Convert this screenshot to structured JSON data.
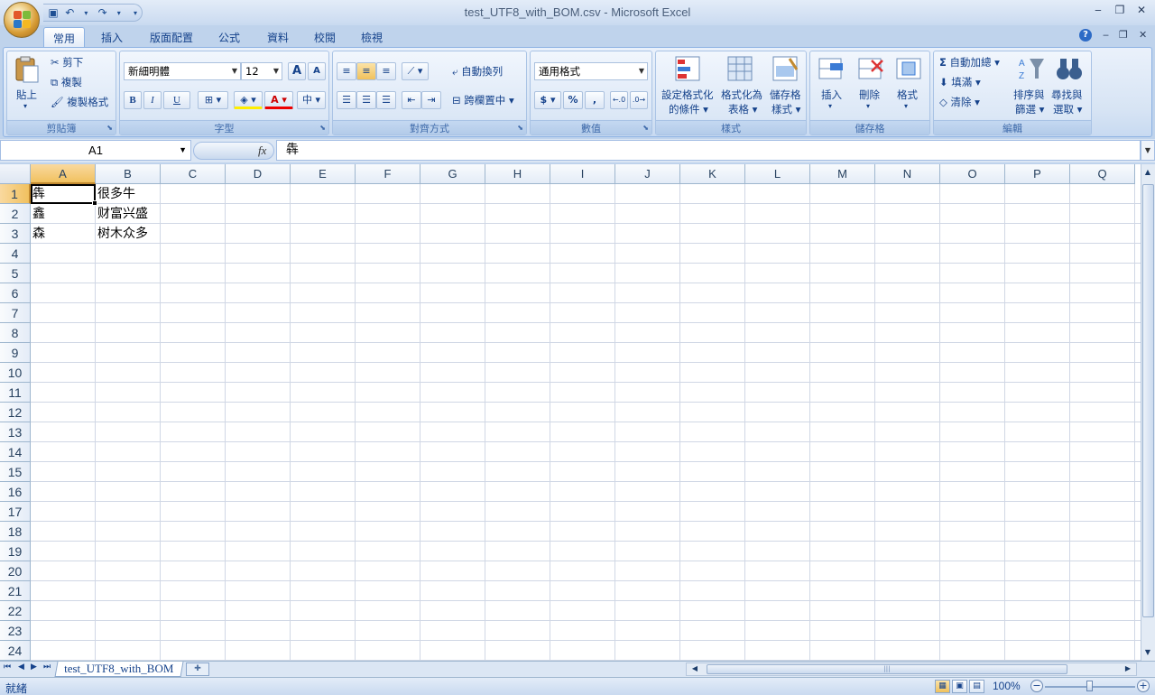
{
  "window": {
    "title": "test_UTF8_with_BOM.csv - Microsoft Excel"
  },
  "tabs": [
    {
      "label": "常用"
    },
    {
      "label": "插入"
    },
    {
      "label": "版面配置"
    },
    {
      "label": "公式"
    },
    {
      "label": "資料"
    },
    {
      "label": "校閱"
    },
    {
      "label": "檢視"
    }
  ],
  "ribbon": {
    "clipboard": {
      "label": "剪貼簿",
      "paste": "貼上",
      "cut": "剪下",
      "copy": "複製",
      "format_painter": "複製格式"
    },
    "font": {
      "label": "字型",
      "font_name": "新細明體",
      "font_size": "12",
      "grow": "A",
      "shrink": "A",
      "bold": "B",
      "italic": "I",
      "underline": "U",
      "font_color": "A",
      "phonetic": "中"
    },
    "alignment": {
      "label": "對齊方式",
      "wrap_text": "自動換列",
      "merge_center": "跨欄置中"
    },
    "number": {
      "label": "數值",
      "format": "通用格式",
      "currency": "$",
      "percent": "%",
      "comma": ","
    },
    "styles": {
      "label": "樣式",
      "conditional": [
        "設定格式化",
        "的條件"
      ],
      "format_table": [
        "格式化為",
        "表格"
      ],
      "cell_styles": [
        "儲存格",
        "樣式"
      ]
    },
    "cells": {
      "label": "儲存格",
      "insert": "插入",
      "delete": "刪除",
      "format": "格式"
    },
    "editing": {
      "label": "編輯",
      "autosum": "自動加總",
      "fill": "填滿",
      "clear": "清除",
      "sort_filter": [
        "排序與",
        "篩選"
      ],
      "find_select": [
        "尋找與",
        "選取"
      ]
    }
  },
  "formula_bar": {
    "name_box": "A1",
    "fx": "fx",
    "value": "犇"
  },
  "grid": {
    "columns": [
      "A",
      "B",
      "C",
      "D",
      "E",
      "F",
      "G",
      "H",
      "I",
      "J",
      "K",
      "L",
      "M",
      "N",
      "O",
      "P",
      "Q"
    ],
    "rows": [
      "1",
      "2",
      "3",
      "4",
      "5",
      "6",
      "7",
      "8",
      "9",
      "10",
      "11",
      "12",
      "13",
      "14",
      "15",
      "16",
      "17",
      "18",
      "19",
      "20",
      "21",
      "22",
      "23",
      "24"
    ],
    "cells": [
      [
        "犇",
        "很多牛"
      ],
      [
        "鑫",
        "财富兴盛"
      ],
      [
        "森",
        "树木众多"
      ]
    ],
    "selected_cell": "A1"
  },
  "sheet_tabs": [
    {
      "label": "test_UTF8_with_BOM"
    }
  ],
  "status": {
    "ready": "就緒",
    "zoom": "100%"
  }
}
